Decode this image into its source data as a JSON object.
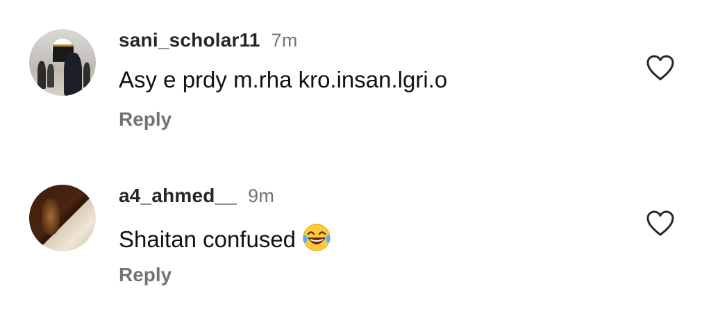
{
  "comments": [
    {
      "username": "sani_scholar11",
      "time": "7m",
      "text": "Asy e prdy m.rha kro.insan.lgri.o",
      "reply_label": "Reply",
      "like_icon": "heart-outline-icon",
      "avatar": "profile-photo"
    },
    {
      "username": "a4_ahmed__",
      "time": "9m",
      "text": "Shaitan confused",
      "emoji": "face-with-tears-of-joy",
      "reply_label": "Reply",
      "like_icon": "heart-outline-icon",
      "avatar": "profile-photo"
    }
  ],
  "colors": {
    "username": "#262626",
    "meta": "#737373",
    "text": "#111111",
    "background": "#ffffff"
  }
}
